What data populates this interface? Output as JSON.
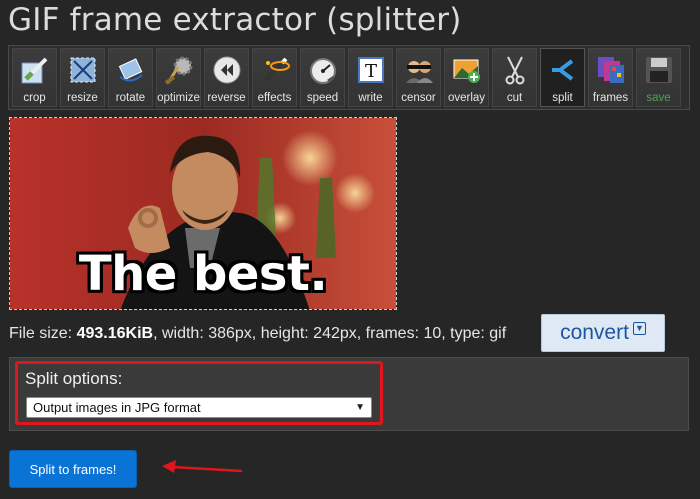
{
  "page": {
    "title": "GIF frame extractor (splitter)"
  },
  "toolbar": {
    "tools": [
      {
        "label": "crop",
        "icon": "crop-icon"
      },
      {
        "label": "resize",
        "icon": "resize-icon"
      },
      {
        "label": "rotate",
        "icon": "rotate-icon"
      },
      {
        "label": "optimize",
        "icon": "optimize-icon"
      },
      {
        "label": "reverse",
        "icon": "reverse-icon"
      },
      {
        "label": "effects",
        "icon": "effects-icon"
      },
      {
        "label": "speed",
        "icon": "speed-icon"
      },
      {
        "label": "write",
        "icon": "write-icon"
      },
      {
        "label": "censor",
        "icon": "censor-icon"
      },
      {
        "label": "overlay",
        "icon": "overlay-icon"
      },
      {
        "label": "cut",
        "icon": "scissors-icon"
      },
      {
        "label": "split",
        "icon": "split-icon",
        "active": true
      },
      {
        "label": "frames",
        "icon": "frames-icon"
      },
      {
        "label": "save",
        "icon": "floppy-disk-icon",
        "disabled": true
      }
    ]
  },
  "preview": {
    "caption": "The best."
  },
  "fileinfo": {
    "size_label": "File size: ",
    "size_value": "493.16KiB",
    "rest": ", width: 386px, height: 242px, frames: 10, type: gif"
  },
  "convert": {
    "label": "convert"
  },
  "split_options": {
    "label": "Split options:",
    "selected": "Output images in JPG format"
  },
  "split_button": {
    "label": "Split to frames!"
  },
  "colors": {
    "accent": "#0a74d6",
    "highlight": "#e0161e",
    "background": "#262626"
  }
}
